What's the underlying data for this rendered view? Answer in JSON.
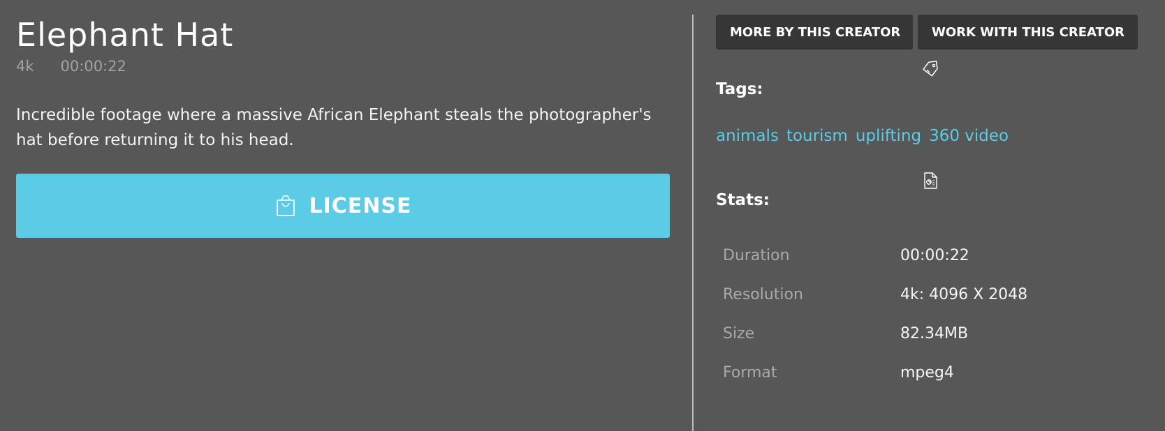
{
  "video": {
    "title": "Elephant Hat",
    "quality": "4k",
    "duration": "00:00:22",
    "description": "Incredible footage where a massive African Elephant steals the photographer's hat before returning it to his head."
  },
  "actions": {
    "license_label": "LICENSE",
    "more_by_creator_label": "MORE BY THIS CREATOR",
    "work_with_creator_label": "WORK WITH THIS CREATOR"
  },
  "tags": {
    "label": "Tags:",
    "items": [
      "animals",
      "tourism",
      "uplifting",
      "360 video"
    ]
  },
  "stats": {
    "label": "Stats:",
    "rows": [
      {
        "key": "Duration",
        "value": "00:00:22"
      },
      {
        "key": "Resolution",
        "value": "4k: 4096 X 2048"
      },
      {
        "key": "Size",
        "value": "82.34MB"
      },
      {
        "key": "Format",
        "value": "mpeg4"
      }
    ]
  },
  "icons": {
    "license": "shopping-bag-icon",
    "tags": "tag-icon",
    "stats": "file-stats-icon"
  },
  "colors": {
    "background": "#575757",
    "accent": "#5bcbe6",
    "dark_button": "#363636"
  }
}
